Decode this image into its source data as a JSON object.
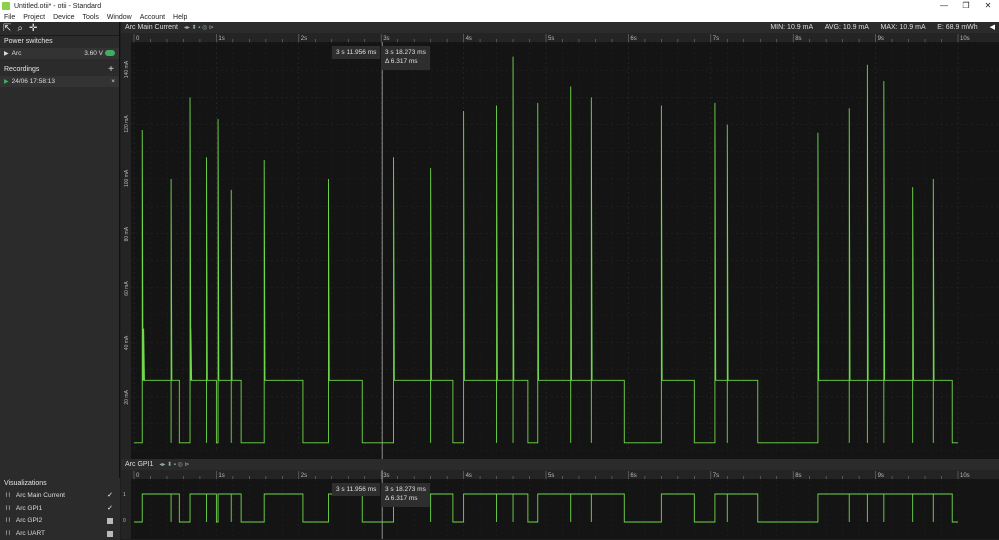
{
  "window": {
    "title": "Untitled.otii* - otii - Standard",
    "minimize": "—",
    "maximize": "❐",
    "close": "✕"
  },
  "menu": [
    "File",
    "Project",
    "Device",
    "Tools",
    "Window",
    "Account",
    "Help"
  ],
  "sidebar": {
    "power_switches_label": "Power switches",
    "device": {
      "name": "Arc",
      "voltage": "3.60 V"
    },
    "recordings_label": "Recordings",
    "recording": {
      "name": "24/06 17:58:13",
      "remove": "×"
    },
    "visualizations_label": "Visualizations",
    "visualizations": [
      {
        "name": "Arc Main Current",
        "checked": true
      },
      {
        "name": "Arc GPI1",
        "checked": true
      },
      {
        "name": "Arc GPI2",
        "checked": false
      },
      {
        "name": "Arc UART",
        "checked": false
      }
    ]
  },
  "main_panel": {
    "title": "Arc Main Current",
    "stats": {
      "min": "MIN: 10.9 mA",
      "avg": "AVG: 10.9 mA",
      "max": "MAX: 10.9 mA",
      "energy": "E: 68.9 mWh"
    },
    "x_ticks": [
      "0",
      "1s",
      "2s",
      "3s",
      "4s",
      "5s",
      "6s",
      "7s",
      "8s",
      "9s",
      "10s"
    ],
    "y_ticks": [
      "20 mA",
      "40 mA",
      "60 mA",
      "80 mA",
      "100 mA",
      "120 mA",
      "140 mA"
    ]
  },
  "gpi_panel": {
    "title": "Arc GPI1",
    "x_ticks": [
      "0",
      "1s",
      "2s",
      "3s",
      "4s",
      "5s",
      "6s",
      "7s",
      "8s",
      "9s",
      "10s"
    ],
    "y_ticks": [
      "1",
      "0"
    ]
  },
  "cursor": {
    "left": "3 s 11.956 ms",
    "right": "3 s 18.273 ms",
    "delta": "Δ 6.317 ms"
  },
  "chart_data": {
    "type": "line",
    "ylabel": "",
    "ylim": [
      0,
      150
    ],
    "xlim": [
      0,
      10
    ],
    "color": "#6fd94a",
    "pulses": [
      {
        "start": 0.1,
        "end": 0.45,
        "spike": 118,
        "spike2": 45
      },
      {
        "start": 0.45,
        "end": 0.55,
        "spike": 100
      },
      {
        "start": 0.68,
        "end": 0.88,
        "spike": 130,
        "spike2": 45
      },
      {
        "start": 0.88,
        "end": 1.0,
        "spike": 108
      },
      {
        "start": 1.02,
        "end": 1.18,
        "spike": 122
      },
      {
        "start": 1.18,
        "end": 1.3,
        "spike": 96
      },
      {
        "start": 1.58,
        "end": 2.05,
        "spike": 107
      },
      {
        "start": 2.36,
        "end": 2.77,
        "spike": 100
      },
      {
        "start": 3.15,
        "end": 3.6,
        "spike": 108
      },
      {
        "start": 3.6,
        "end": 3.87,
        "spike": 104
      },
      {
        "start": 4.0,
        "end": 4.4,
        "spike": 125
      },
      {
        "start": 4.4,
        "end": 4.6,
        "spike": 127
      },
      {
        "start": 4.6,
        "end": 4.78,
        "spike": 145
      },
      {
        "start": 4.9,
        "end": 5.3,
        "spike": 128
      },
      {
        "start": 5.3,
        "end": 5.55,
        "spike": 134
      },
      {
        "start": 5.55,
        "end": 5.95,
        "spike": 130
      },
      {
        "start": 6.4,
        "end": 6.8,
        "spike": 127
      },
      {
        "start": 7.05,
        "end": 7.2,
        "spike": 128
      },
      {
        "start": 7.2,
        "end": 7.57,
        "spike": 120
      },
      {
        "start": 8.3,
        "end": 8.68,
        "spike": 117
      },
      {
        "start": 8.68,
        "end": 8.9,
        "spike": 126
      },
      {
        "start": 8.9,
        "end": 9.1,
        "spike": 142
      },
      {
        "start": 9.1,
        "end": 9.45,
        "spike": 136
      },
      {
        "start": 9.45,
        "end": 9.7,
        "spike": 97
      },
      {
        "start": 9.7,
        "end": 9.93,
        "spike": 100
      }
    ],
    "baseline": 3,
    "plateau": 26
  }
}
